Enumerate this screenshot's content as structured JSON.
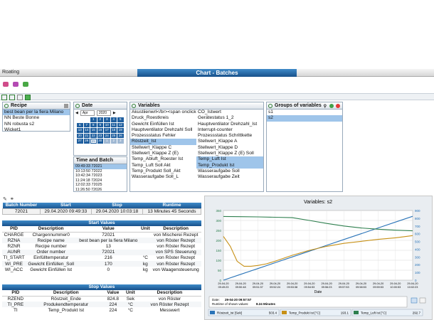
{
  "app": {
    "name": "Roating",
    "title": "Chart - Batches"
  },
  "colors": {
    "accent": "#1f6fb5",
    "header_blue": "#17508a",
    "selection": "#9fc5ea",
    "roest_line": "#2a74b8",
    "produkt_line": "#c79016",
    "luft_line": "#2e7f4e"
  },
  "recipe": {
    "header": "Recipe",
    "items": [
      "best bean per la fiera Milano",
      "NN Beste Bonne",
      "NN robusta s2",
      "Wicket1"
    ]
  },
  "date": {
    "header": "Date",
    "month": "Apr",
    "year": "2020",
    "weekdays": [
      "",
      "",
      "",
      "",
      "",
      "",
      ""
    ],
    "days": [
      "",
      "",
      "1",
      "2",
      "3",
      "4",
      "5",
      "6",
      "7",
      "8",
      "9",
      "10",
      "11",
      "12",
      "13",
      "14",
      "15",
      "16",
      "17",
      "18",
      "19",
      "20",
      "21",
      "22",
      "23",
      "24",
      "25",
      "26",
      "27",
      "28",
      "29",
      "30",
      "1",
      "2",
      "3"
    ]
  },
  "time_batch": {
    "header": "Time and Batch",
    "items": [
      "09:49:33 72021",
      "10:13:50 72022",
      "10:42:34 72023",
      "11:24:18 72024",
      "12:02:33 72025",
      "11:26:50 72026"
    ]
  },
  "variables": {
    "header": "Variables",
    "col1": [
      "Akustiienwrl&lt;/br&gt;&lt;span onclick=",
      "Druck_Roestkreis",
      "Gewicht Einfüllen Ist",
      "Hauptventilator Drehzahl Soll",
      "Prozessstatus Fehler",
      "Röstzeit_Ist",
      "Stellwert_Klappe C",
      "Stellwert_Klappe Z (E)",
      "Temp_Abluft_Roester Ist",
      "Temp_Luft Soll Akt",
      "Temp_Produkt Soll_Akt",
      "Wasseraufgabe Soll_L"
    ],
    "col2": [
      "CO_Istwert",
      "Gerätestatus 1_2",
      "Hauptventilator Drehzahl_Ist",
      "Interrupt-counter",
      "Prozessstatus Schrittkette",
      "Stellwert_Klappe A",
      "Stellwert_Klappe D",
      "Stellwert_Klappe Z (E) Soll",
      "Temp_Luft Ist",
      "Temp_Produkt Ist",
      "Wasseraufgabe Soll",
      "Wasseraufgabe Zeit"
    ]
  },
  "groups": {
    "header": "Groups of variables",
    "items": [
      "s1",
      "s2"
    ]
  },
  "batch_table": {
    "headers": [
      "Batch Number",
      "Start",
      "Stop",
      "Runtime"
    ],
    "row": [
      "72021",
      "29.04.2020 09:49:33",
      "29.04.2020 10:03:18",
      "13 Minutes 45 Seconds"
    ]
  },
  "start_values": {
    "title": "Start Values",
    "headers": [
      "PID",
      "Description",
      "Value",
      "Unit",
      "Description"
    ],
    "rows": [
      [
        "CHARGE",
        "Chargennummer0",
        "72021",
        "",
        "von Mischerei Rezept"
      ],
      [
        "RZNA",
        "Recipe name",
        "best bean per la fiera Milano",
        "",
        "von Röster Rezept"
      ],
      [
        "RZNR",
        "Recipe number",
        "13",
        "",
        "von Röster Rezept"
      ],
      [
        "AUNR",
        "Order number",
        "72021",
        "",
        "von SPS Steuerung"
      ],
      [
        "TI_START",
        "Einfülltemperatur",
        "216",
        "°C",
        "von Röster Rezept"
      ],
      [
        "WI_PRE",
        "Gewicht Einfüllen_Soll",
        "170",
        "kg",
        "von Röster Rezept"
      ],
      [
        "WI_ACC",
        "Gewicht Einfüllen Ist",
        "0",
        "kg",
        "von Waagensteuerung"
      ]
    ]
  },
  "stop_values": {
    "title": "Stop Values",
    "headers": [
      "PID",
      "Description",
      "Value",
      "Unit",
      "Description"
    ],
    "rows": [
      [
        "RZEND",
        "Röstzeit_Ende",
        "824.8",
        "Sek",
        "von Röster"
      ],
      [
        "TI_PRE",
        "Produkendtemperatur",
        "224",
        "°C",
        "von Röster Rezept"
      ],
      [
        "TI",
        "Temp_Produkt Ist",
        "224",
        "°C",
        "Messwert"
      ]
    ]
  },
  "chart_data": {
    "type": "line",
    "title": "Variables: s2",
    "xlabel": "Date",
    "ylabel": "",
    "ylim": [
      0,
      350
    ],
    "y2lim": [
      0,
      900
    ],
    "y_ticks": [
      "0",
      "50",
      "100",
      "150",
      "200",
      "250",
      "300",
      "350"
    ],
    "y2_ticks": [
      "0",
      "100",
      "200",
      "300",
      "400",
      "500",
      "600",
      "700",
      "800",
      "900"
    ],
    "x_ticks": [
      [
        "29-04-20",
        "09:49:23"
      ],
      [
        "29-04-20",
        "09:50:48"
      ],
      [
        "29-04-20",
        "09:51:37"
      ],
      [
        "29-04-20",
        "09:52:24"
      ],
      [
        "29-04-20",
        "09:53:38"
      ],
      [
        "29-04-20",
        "09:54:53"
      ],
      [
        "29-04-20",
        "09:56:23"
      ],
      [
        "29-04-20",
        "09:57:53"
      ],
      [
        "29-04-20",
        "09:58:53"
      ],
      [
        "29-04-20",
        "09:59:53"
      ],
      [
        "29-04-20",
        "10:00:53"
      ],
      [
        "29-04-20",
        "10:02:23"
      ]
    ],
    "series": [
      {
        "name": "Röstzeit_Ist [Sek]",
        "axis": "right",
        "color": "#2a74b8",
        "x": [
          0,
          1,
          2,
          3,
          4,
          5,
          6,
          7,
          8,
          9,
          10,
          11
        ],
        "y": [
          0,
          75,
          150,
          225,
          300,
          375,
          450,
          525,
          600,
          675,
          750,
          825
        ]
      },
      {
        "name": "Temp_Produkt Ist [°C]",
        "axis": "left",
        "color": "#c79016",
        "x": [
          0,
          0.4,
          0.8,
          1.2,
          1.6,
          2,
          2.5,
          3,
          4,
          5,
          6,
          7,
          8,
          9,
          10,
          11
        ],
        "y": [
          220,
          170,
          95,
          70,
          70,
          74,
          82,
          95,
          125,
          150,
          170,
          185,
          195,
          205,
          213,
          224
        ]
      },
      {
        "name": "Temp_Luft Ist [°C]",
        "axis": "left",
        "color": "#2e7f4e",
        "x": [
          0,
          1,
          2,
          3,
          4,
          5,
          6,
          7,
          8,
          9,
          10,
          11
        ],
        "y": [
          320,
          319,
          318,
          316,
          314,
          300,
          285,
          272,
          262,
          256,
          251,
          248
        ]
      }
    ],
    "footer": {
      "date_label": "Date:",
      "date_value": "29-04-20 09:57:57",
      "runtime_label": "Runtime of shown values:",
      "runtime_value": "8.24 Minutes",
      "legend_values": [
        "503.4",
        "193.1",
        "292.7"
      ]
    }
  }
}
